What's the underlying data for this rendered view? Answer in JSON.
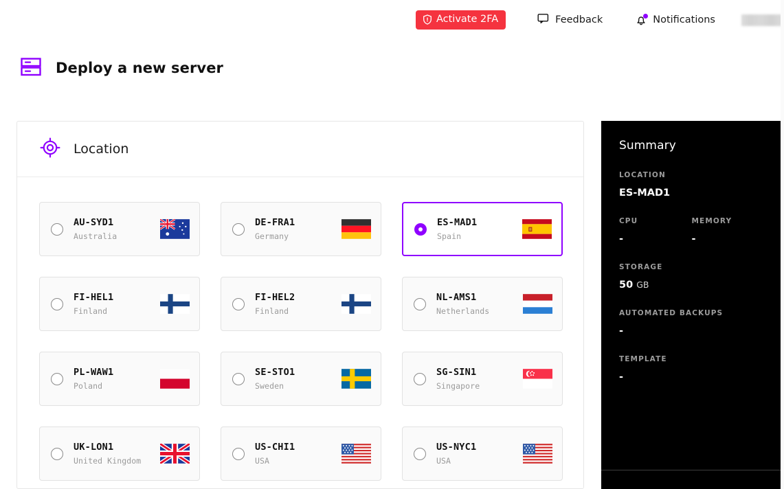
{
  "topbar": {
    "activate_2fa": "Activate 2FA",
    "feedback": "Feedback",
    "notifications": "Notifications",
    "user_redacted": ""
  },
  "heading": {
    "title": "Deploy a new server"
  },
  "panel": {
    "section_title": "Location",
    "locations": [
      {
        "code": "AU-SYD1",
        "country": "Australia",
        "flag": "au",
        "selected": false
      },
      {
        "code": "DE-FRA1",
        "country": "Germany",
        "flag": "de",
        "selected": false
      },
      {
        "code": "ES-MAD1",
        "country": "Spain",
        "flag": "es",
        "selected": true
      },
      {
        "code": "FI-HEL1",
        "country": "Finland",
        "flag": "fi",
        "selected": false
      },
      {
        "code": "FI-HEL2",
        "country": "Finland",
        "flag": "fi",
        "selected": false
      },
      {
        "code": "NL-AMS1",
        "country": "Netherlands",
        "flag": "nl",
        "selected": false
      },
      {
        "code": "PL-WAW1",
        "country": "Poland",
        "flag": "pl",
        "selected": false
      },
      {
        "code": "SE-STO1",
        "country": "Sweden",
        "flag": "se",
        "selected": false
      },
      {
        "code": "SG-SIN1",
        "country": "Singapore",
        "flag": "sg",
        "selected": false
      },
      {
        "code": "UK-LON1",
        "country": "United Kingdom",
        "flag": "uk",
        "selected": false
      },
      {
        "code": "US-CHI1",
        "country": "USA",
        "flag": "us",
        "selected": false
      },
      {
        "code": "US-NYC1",
        "country": "USA",
        "flag": "us",
        "selected": false
      }
    ]
  },
  "summary": {
    "title": "Summary",
    "location_label": "LOCATION",
    "location_value": "ES-MAD1",
    "cpu_label": "CPU",
    "cpu_value": "-",
    "memory_label": "MEMORY",
    "memory_value": "-",
    "storage_label": "STORAGE",
    "storage_value": "50",
    "storage_unit": "GB",
    "backups_label": "AUTOMATED BACKUPS",
    "backups_value": "-",
    "template_label": "TEMPLATE",
    "template_value": "-"
  },
  "colors": {
    "accent": "#8f00ff",
    "danger": "#f5333f",
    "summary_bg": "#000000",
    "card_bg": "#fafafa"
  }
}
